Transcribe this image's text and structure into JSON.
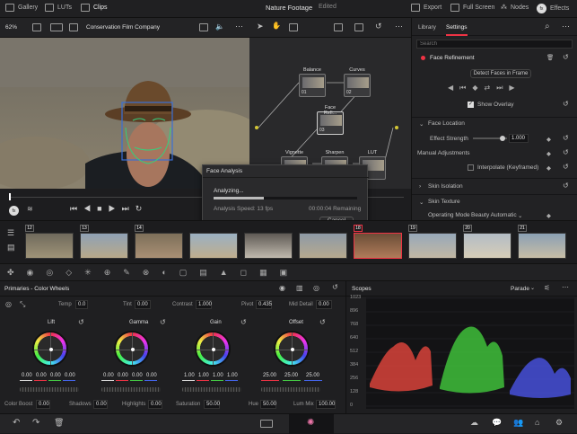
{
  "topbar": {
    "gallery": "Gallery",
    "luts": "LUTs",
    "clips": "Clips",
    "title": "Nature Footage",
    "status": "Edited",
    "export": "Export",
    "fullscreen": "Full Screen",
    "nodes": "Nodes",
    "effects": "Effects"
  },
  "viewer_toolbar": {
    "zoom": "62%",
    "clip_name": "Conservation Film Company"
  },
  "nodes": [
    {
      "label": "Balance",
      "num": "01"
    },
    {
      "label": "Curves",
      "num": "02"
    },
    {
      "label": "Face Refi...",
      "num": "03"
    },
    {
      "label": "Vignette",
      "num": "04"
    },
    {
      "label": "Sharpen",
      "num": "05"
    },
    {
      "label": "LUT",
      "num": "06"
    }
  ],
  "dialog": {
    "title": "Face Analysis",
    "analyzing": "Analyzing...",
    "speed": "Analysis Speed: 13 fps",
    "remaining": "00:00:04 Remaining",
    "cancel": "Cancel",
    "progress": 0.35
  },
  "inspector": {
    "tab_library": "Library",
    "tab_settings": "Settings",
    "search_placeholder": "Search",
    "section": "Face Refinement",
    "detect": "Detect Faces in Frame",
    "show_overlay": "Show Overlay",
    "face_location": "Face Location",
    "effect_strength": "Effect Strength",
    "effect_strength_value": "1.000",
    "manual": "Manual Adjustments",
    "interpolate": "Interpolate (Keyframed)",
    "skin_isolation": "Skin Isolation",
    "skin_texture": "Skin Texture",
    "operating_mode": "Operating Mode",
    "operating_mode_value": "Beauty Automatic"
  },
  "clips": [
    {
      "num": "12"
    },
    {
      "num": "13"
    },
    {
      "num": "14"
    },
    {
      "num": ""
    },
    {
      "num": ""
    },
    {
      "num": ""
    },
    {
      "num": "18"
    },
    {
      "num": "19"
    },
    {
      "num": "20"
    },
    {
      "num": "21"
    }
  ],
  "primaries": {
    "title": "Primaries - Color Wheels",
    "temp_label": "Temp",
    "temp": "0.0",
    "tint_label": "Tint",
    "tint": "0.00",
    "contrast_label": "Contrast",
    "contrast": "1.000",
    "pivot_label": "Pivot",
    "pivot": "0.435",
    "middetail_label": "Mid Detail",
    "middetail": "0.00",
    "wheels": [
      {
        "name": "Lift",
        "vals": [
          "0.00",
          "0.00",
          "0.00",
          "0.00"
        ]
      },
      {
        "name": "Gamma",
        "vals": [
          "0.00",
          "0.00",
          "0.00",
          "0.00"
        ]
      },
      {
        "name": "Gain",
        "vals": [
          "1.00",
          "1.00",
          "1.00",
          "1.00"
        ]
      },
      {
        "name": "Offset",
        "vals": [
          "25.00",
          "25.00",
          "25.00"
        ]
      }
    ],
    "colorboost_label": "Color Boost",
    "colorboost": "0.00",
    "shadows_label": "Shadows",
    "shadows": "0.00",
    "highlights_label": "Highlights",
    "highlights": "0.00",
    "saturation_label": "Saturation",
    "saturation": "50.00",
    "hue_label": "Hue",
    "hue": "50.00",
    "lummix_label": "Lum Mix",
    "lummix": "100.00"
  },
  "scopes": {
    "title": "Scopes",
    "mode": "Parade",
    "ticks": [
      "1023",
      "896",
      "768",
      "640",
      "512",
      "384",
      "256",
      "128",
      "0"
    ]
  }
}
